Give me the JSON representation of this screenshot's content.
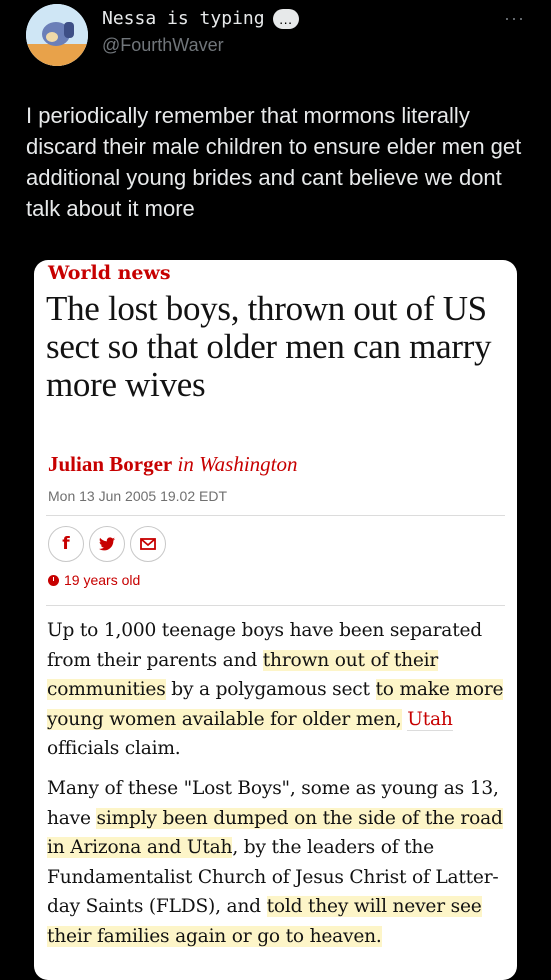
{
  "tweet": {
    "display_name": "Nessa is typing",
    "typing_icon": "…",
    "handle": "@FourthWaver",
    "more_icon": "···",
    "text": "I periodically remember that mormons literally discard their male children to ensure elder men get additional young brides and cant believe we dont talk about it more"
  },
  "article": {
    "section": "World news",
    "headline": "The lost boys, thrown out of US sect so that older men can marry more wives",
    "author": "Julian Borger",
    "location": "in Washington",
    "date": "Mon 13 Jun 2005 19.02 EDT",
    "share": {
      "facebook": "f",
      "twitter": "🐦",
      "email": "✉"
    },
    "age": "19 years old",
    "p1": {
      "a": "Up to 1,000 teenage boys have been separated from their parents and ",
      "b": "thrown out of their communities",
      "c": " by a polygamous sect ",
      "d": "to make more young women available for older men,",
      "e": " ",
      "f": "Utah",
      "g": " officials claim."
    },
    "p2": {
      "a": "Many of these \"Lost Boys\", some as young as 13, have ",
      "b": "simply been dumped on the side of the road in Arizona and Utah",
      "c": ", by the leaders of the Fundamentalist Church of Jesus Christ of Latter-day Saints (FLDS), and ",
      "d": "told they will never see their families again or go to heaven."
    }
  },
  "colors": {
    "background": "#000000",
    "guardian_red": "#c70000",
    "highlight": "#fdf5c8"
  }
}
